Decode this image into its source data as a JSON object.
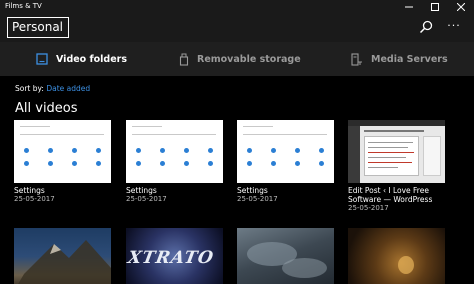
{
  "app": {
    "title": "Films & TV"
  },
  "header": {
    "pivot_label": "Personal",
    "more_label": "···"
  },
  "source_tabs": [
    {
      "label": "Video folders",
      "icon": "folder-icon",
      "active": true
    },
    {
      "label": "Removable storage",
      "icon": "usb-icon",
      "active": false
    },
    {
      "label": "Media Servers",
      "icon": "server-icon",
      "active": false
    }
  ],
  "sort": {
    "label": "Sort by:",
    "value": "Date added"
  },
  "section": {
    "title": "All videos"
  },
  "videos": [
    {
      "title": "Settings",
      "date": "25-05-2017",
      "thumb": "settings"
    },
    {
      "title": "Settings",
      "date": "25-05-2017",
      "thumb": "settings"
    },
    {
      "title": "Settings",
      "date": "25-05-2017",
      "thumb": "settings"
    },
    {
      "title": "Edit Post ‹ I Love Free Software — WordPress",
      "date": "25-05-2017",
      "thumb": "edit-post"
    },
    {
      "title": "",
      "date": "",
      "thumb": "mountain"
    },
    {
      "title": "",
      "date": "",
      "thumb": "xtrator-logo"
    },
    {
      "title": "",
      "date": "",
      "thumb": "clouds"
    },
    {
      "title": "",
      "date": "",
      "thumb": "fire"
    }
  ],
  "colors": {
    "accent": "#3c8fe2",
    "background": "#000000",
    "header": "#1a1a1a",
    "source_bar": "#1f1f1f"
  },
  "thumb_text": {
    "xtrator": "XTRATO"
  }
}
